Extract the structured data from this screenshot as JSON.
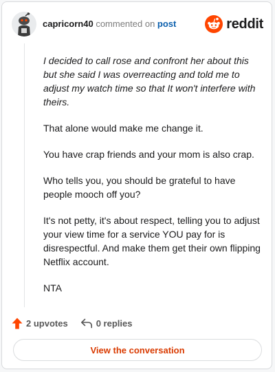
{
  "header": {
    "username": "capricorn40",
    "action_text": " commented on ",
    "target_text": "post",
    "brand_name": "reddit",
    "avatar_icon": "snoo-avatar-icon",
    "brand_icon": "reddit-logo-icon"
  },
  "comment": {
    "paragraphs": [
      "I decided to call rose and confront her about this but she said I was overreacting and told me to adjust my watch time so that It won't interfere with theirs.",
      "That alone would make me change it.",
      "You have crap friends and your mom is also crap.",
      "Who tells you, you should be grateful to have people mooch off you?",
      "It's not petty, it's about respect, telling you to adjust your view time for a service YOU pay for is disrespectful. And make them get their own flipping Netflix account.",
      "NTA"
    ]
  },
  "actions": {
    "upvotes_label": "2 upvotes",
    "replies_label": "0 replies",
    "upvote_icon": "upvote-arrow-icon",
    "reply_icon": "reply-arrow-icon"
  },
  "cta": {
    "label": "View the conversation"
  },
  "colors": {
    "brand": "#ff4500",
    "link": "#0b5fad",
    "cta_text": "#d93a00",
    "text": "#1a1a1b"
  }
}
